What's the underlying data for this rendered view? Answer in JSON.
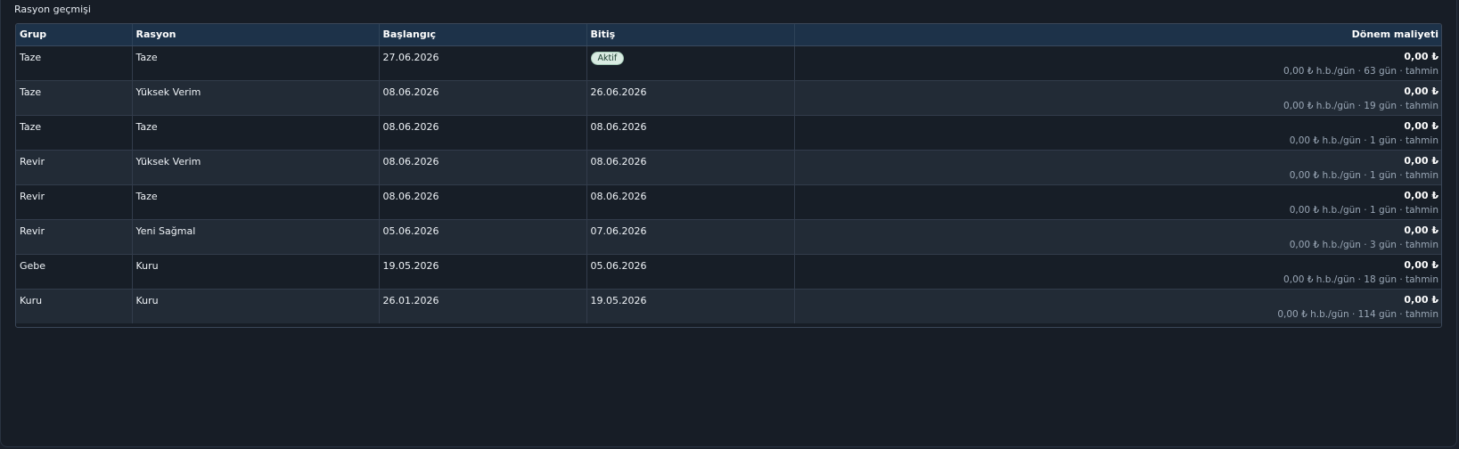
{
  "title": "Rasyon geçmişi",
  "columns": {
    "grup": "Grup",
    "rasyon": "Rasyon",
    "baslangic": "Başlangıç",
    "bitis": "Bitiş",
    "maliyet": "Dönem maliyeti"
  },
  "rows": [
    {
      "grup": "Taze",
      "rasyon": "Taze",
      "baslangic": "27.06.2026",
      "bitis": "",
      "badge": "Aktif",
      "cost": "0,00 ₺",
      "cost_detail": "0,00 ₺ h.b./gün · 63 gün · tahmin"
    },
    {
      "grup": "Taze",
      "rasyon": "Yüksek Verim",
      "baslangic": "08.06.2026",
      "bitis": "26.06.2026",
      "badge": "",
      "cost": "0,00 ₺",
      "cost_detail": "0,00 ₺ h.b./gün · 19 gün · tahmin"
    },
    {
      "grup": "Taze",
      "rasyon": "Taze",
      "baslangic": "08.06.2026",
      "bitis": "08.06.2026",
      "badge": "",
      "cost": "0,00 ₺",
      "cost_detail": "0,00 ₺ h.b./gün · 1 gün · tahmin"
    },
    {
      "grup": "Revir",
      "rasyon": "Yüksek Verim",
      "baslangic": "08.06.2026",
      "bitis": "08.06.2026",
      "badge": "",
      "cost": "0,00 ₺",
      "cost_detail": "0,00 ₺ h.b./gün · 1 gün · tahmin"
    },
    {
      "grup": "Revir",
      "rasyon": "Taze",
      "baslangic": "08.06.2026",
      "bitis": "08.06.2026",
      "badge": "",
      "cost": "0,00 ₺",
      "cost_detail": "0,00 ₺ h.b./gün · 1 gün · tahmin"
    },
    {
      "grup": "Revir",
      "rasyon": "Yeni Sağmal",
      "baslangic": "05.06.2026",
      "bitis": "07.06.2026",
      "badge": "",
      "cost": "0,00 ₺",
      "cost_detail": "0,00 ₺ h.b./gün · 3 gün · tahmin"
    },
    {
      "grup": "Gebe",
      "rasyon": "Kuru",
      "baslangic": "19.05.2026",
      "bitis": "05.06.2026",
      "badge": "",
      "cost": "0,00 ₺",
      "cost_detail": "0,00 ₺ h.b./gün · 18 gün · tahmin"
    },
    {
      "grup": "Kuru",
      "rasyon": "Kuru",
      "baslangic": "26.01.2026",
      "bitis": "19.05.2026",
      "badge": "",
      "cost": "0,00 ₺",
      "cost_detail": "0,00 ₺ h.b./gün · 114 gün · tahmin"
    }
  ]
}
